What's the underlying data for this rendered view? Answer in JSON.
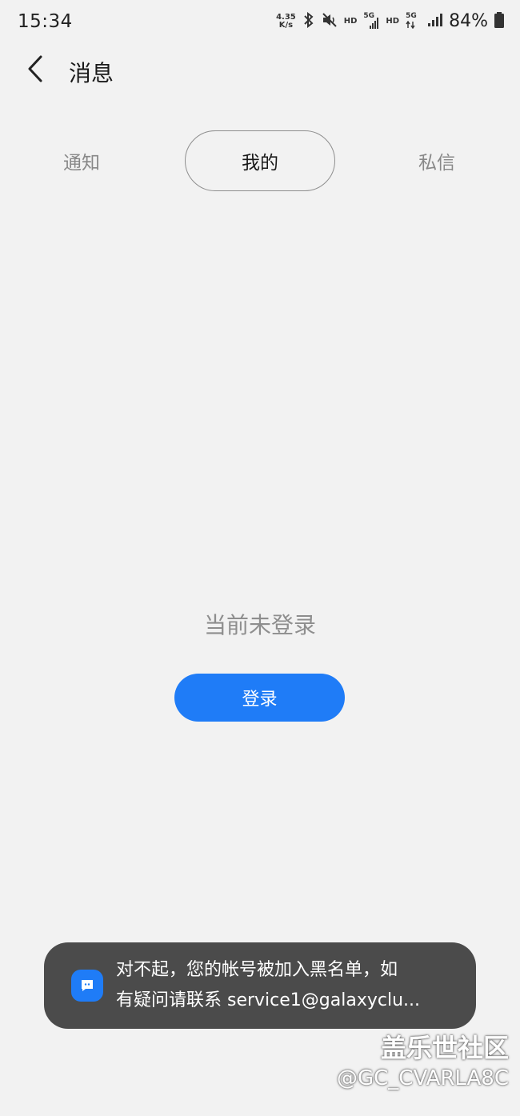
{
  "status_bar": {
    "time": "15:34",
    "net_speed_value": "4.35",
    "net_speed_unit": "K/s",
    "hd_label_1": "HD",
    "g5_label_1": "5G",
    "hd_label_2": "HD",
    "g5_label_2": "5G",
    "battery_percent": "84%",
    "icons": [
      "bluetooth-icon",
      "mute-icon",
      "signal-icon",
      "battery-icon"
    ]
  },
  "header": {
    "title": "消息",
    "back_icon": "chevron-left-icon"
  },
  "tabs": [
    {
      "label": "通知",
      "selected": false
    },
    {
      "label": "我的",
      "selected": true
    },
    {
      "label": "私信",
      "selected": false
    }
  ],
  "empty_state": {
    "message": "当前未登录",
    "login_label": "登录"
  },
  "toast": {
    "line1": "对不起，您的帐号被加入黑名单，如",
    "line2": "有疑问请联系 service1@galaxyclu...",
    "icon": "chat-bubble-icon"
  },
  "watermark": {
    "site": "盖乐世社区",
    "user": "@GC_CVARLA8C"
  },
  "colors": {
    "background": "#f2f2f2",
    "accent": "#1f7cf7",
    "toast_bg": "#4b4b4b"
  }
}
